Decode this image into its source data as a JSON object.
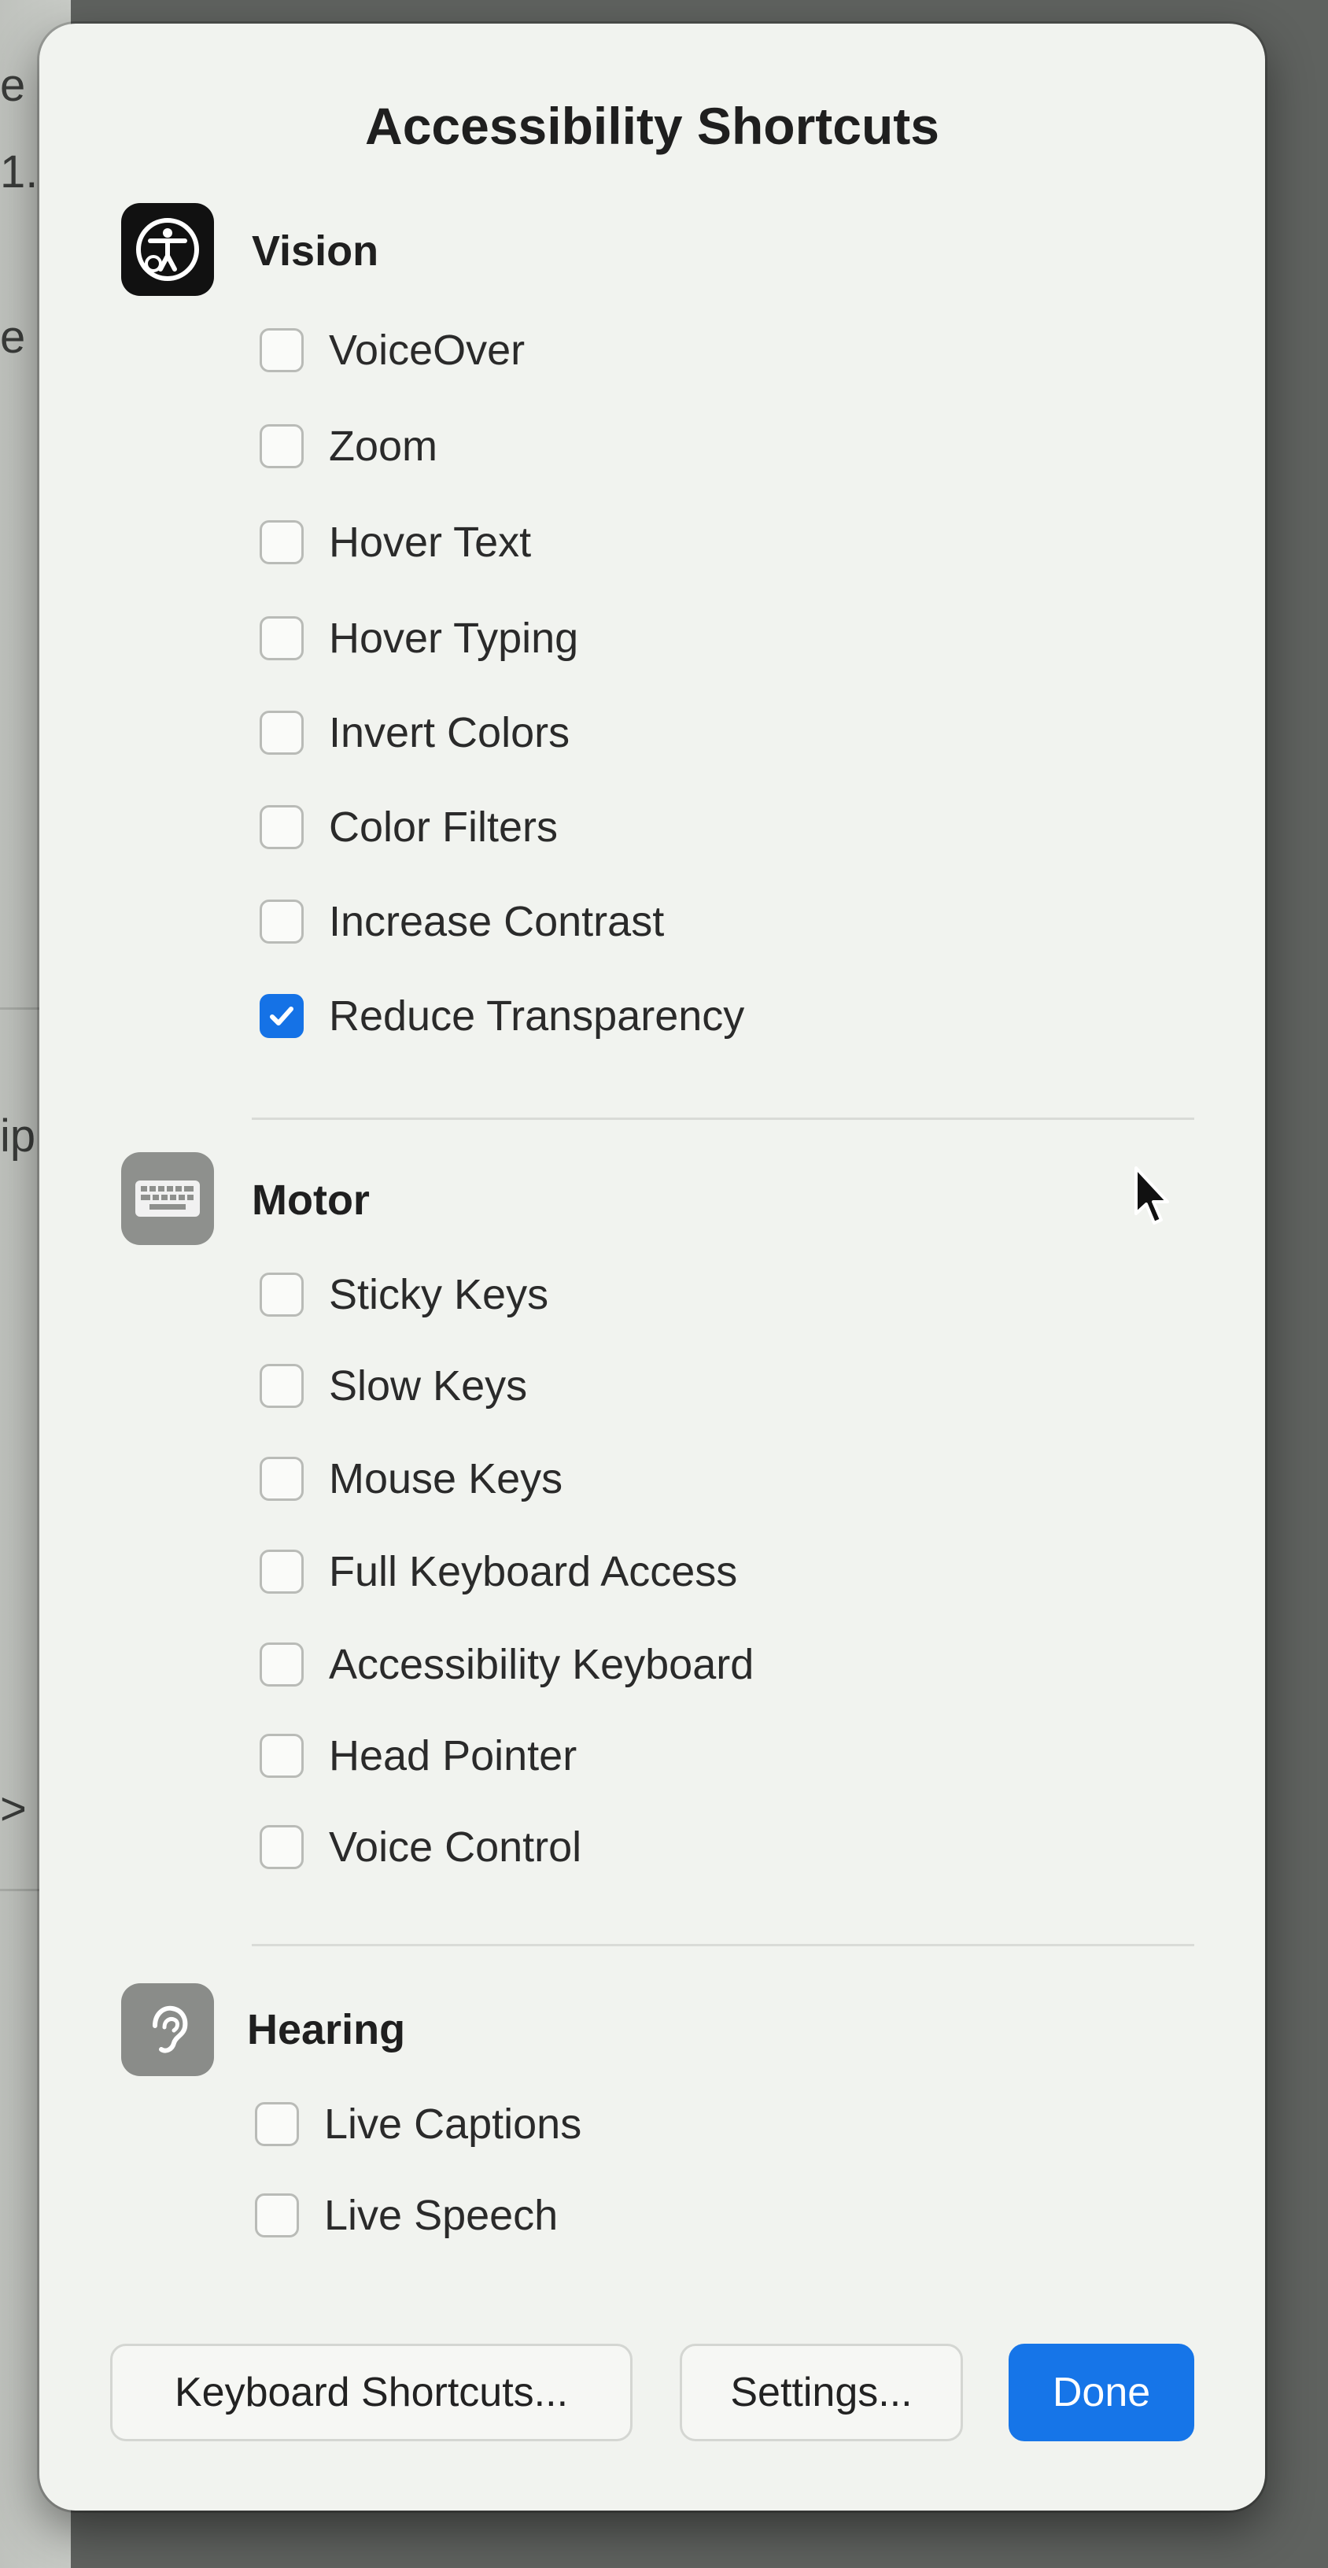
{
  "dialog": {
    "title": "Accessibility Shortcuts"
  },
  "background_fragments": [
    "e",
    "1.",
    "e",
    "ip",
    ">"
  ],
  "sections": [
    {
      "title": "Vision",
      "icon": "accessibility-icon",
      "options": [
        {
          "label": "VoiceOver",
          "checked": false
        },
        {
          "label": "Zoom",
          "checked": false
        },
        {
          "label": "Hover Text",
          "checked": false
        },
        {
          "label": "Hover Typing",
          "checked": false
        },
        {
          "label": "Invert Colors",
          "checked": false
        },
        {
          "label": "Color Filters",
          "checked": false
        },
        {
          "label": "Increase Contrast",
          "checked": false
        },
        {
          "label": "Reduce Transparency",
          "checked": true
        }
      ]
    },
    {
      "title": "Motor",
      "icon": "keyboard-icon",
      "options": [
        {
          "label": "Sticky Keys",
          "checked": false
        },
        {
          "label": "Slow Keys",
          "checked": false
        },
        {
          "label": "Mouse Keys",
          "checked": false
        },
        {
          "label": "Full Keyboard Access",
          "checked": false
        },
        {
          "label": "Accessibility Keyboard",
          "checked": false
        },
        {
          "label": "Head Pointer",
          "checked": false
        },
        {
          "label": "Voice Control",
          "checked": false
        }
      ]
    },
    {
      "title": "Hearing",
      "icon": "ear-icon",
      "options": [
        {
          "label": "Live Captions",
          "checked": false
        },
        {
          "label": "Live Speech",
          "checked": false
        }
      ]
    }
  ],
  "buttons": {
    "keyboard_shortcuts": "Keyboard Shortcuts...",
    "settings": "Settings...",
    "done": "Done"
  },
  "colors": {
    "accent": "#1675e8",
    "dialog_background": "#f1f3ef"
  }
}
